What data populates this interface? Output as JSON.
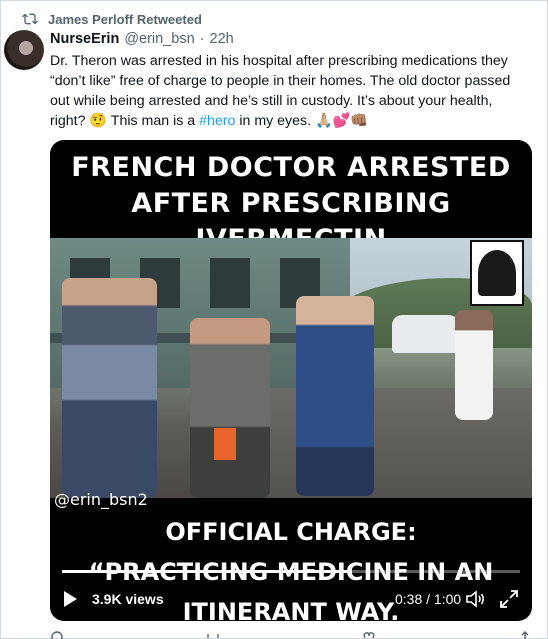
{
  "retweet": {
    "label": "James Perloff Retweeted",
    "icon": "retweet-icon"
  },
  "author": {
    "display_name": "NurseErin",
    "handle": "@erin_bsn",
    "separator": "·",
    "time": "22h"
  },
  "tweet": {
    "text_before_hashtag": "Dr. Theron was arrested in his hospital after prescribing medications they “don’t like” free of charge to people in their homes. The old doctor passed out while being arrested and he’s still in custody. It’s about your health, right? 🤨 This man is a ",
    "hashtag": "#hero",
    "text_after_hashtag": " in my eyes. 🙏🏼💕👊🏽"
  },
  "video": {
    "headline_line1": "FRENCH DOCTOR ARRESTED",
    "headline_line2": "AFTER PRESCRIBING IVERMECTIN",
    "watermark": "@erin_bsn2",
    "caption_line1": "OFFICIAL CHARGE:",
    "caption_line2": "“PRACTICING MEDICINE IN AN",
    "caption_line3": "ITINERANT WAY.",
    "views": "3.9K views",
    "elapsed": "0:38",
    "duration": "1:00",
    "time_separator": " / ",
    "progress_fraction": 0.633
  },
  "colors": {
    "accent": "#1d9bf0",
    "secondary_text": "#536471",
    "primary_text": "#0f1419"
  }
}
